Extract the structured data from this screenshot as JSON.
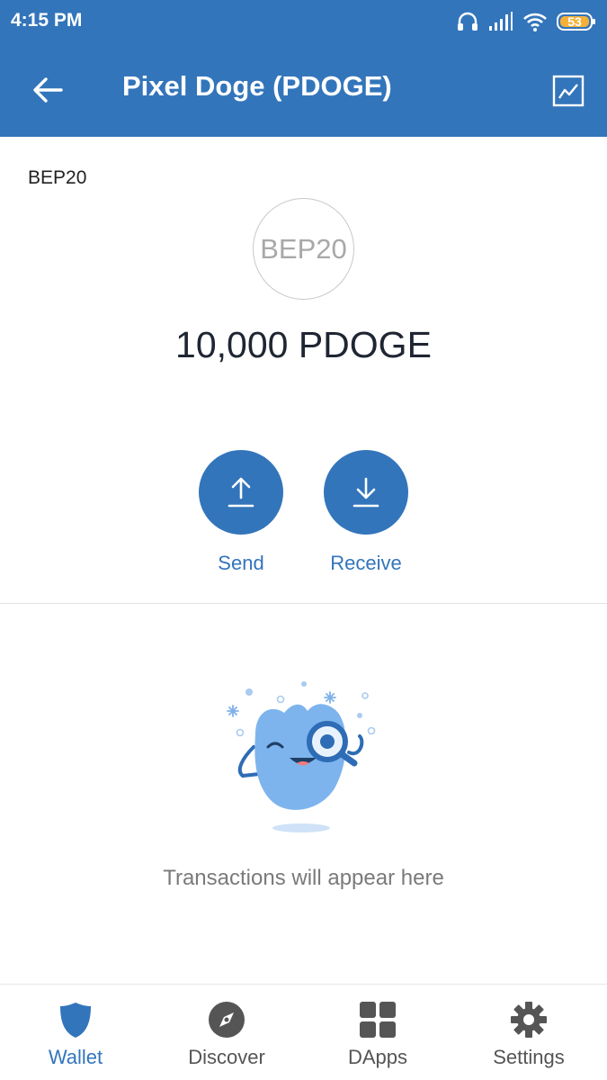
{
  "status_bar": {
    "time": "4:15 PM",
    "battery": "53",
    "icons": [
      "headphones-icon",
      "signal-icon",
      "wifi-icon",
      "battery-icon"
    ]
  },
  "app_bar": {
    "title": "Pixel Doge (PDOGE)",
    "back_icon": "arrow-left-icon",
    "chart_icon": "price-chart-icon"
  },
  "token": {
    "network": "BEP20",
    "logo_text": "BEP20",
    "balance": "10,000 PDOGE"
  },
  "actions": [
    {
      "label": "Send",
      "icon": "arrow-up-icon"
    },
    {
      "label": "Receive",
      "icon": "arrow-down-icon"
    }
  ],
  "empty_state": {
    "text": "Transactions will appear here",
    "illustration": "winking-mascot-magnifier"
  },
  "bottom_nav": [
    {
      "label": "Wallet",
      "icon": "shield-icon",
      "active": true
    },
    {
      "label": "Discover",
      "icon": "compass-icon",
      "active": false
    },
    {
      "label": "DApps",
      "icon": "grid-icon",
      "active": false
    },
    {
      "label": "Settings",
      "icon": "gear-icon",
      "active": false
    }
  ],
  "colors": {
    "primary": "#3375BB",
    "text_dark": "#1f2533",
    "text_muted": "#7a7a7a",
    "nav_inactive": "#555555"
  }
}
